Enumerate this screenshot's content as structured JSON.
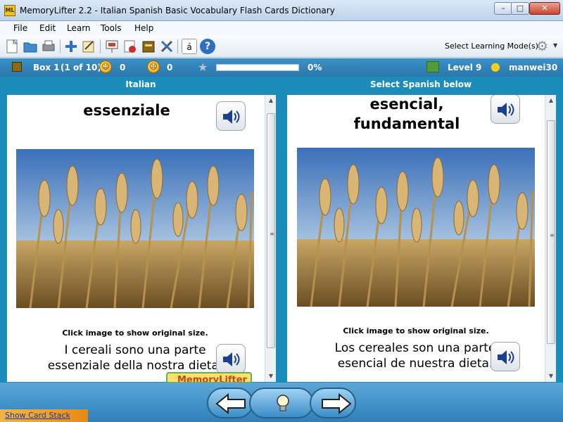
{
  "window": {
    "title": "MemoryLifter 2.2 - Italian Spanish Basic Vocabulary Flash Cards Dictionary",
    "app_icon_text": "ML",
    "minimize_glyph": "–",
    "maximize_glyph": "□",
    "close_glyph": "✕"
  },
  "menu": [
    "File",
    "Edit",
    "Learn",
    "Tools",
    "Help"
  ],
  "toolbar": {
    "icons": [
      "new-file-icon",
      "open-folder-icon",
      "print-icon",
      "add-card-icon",
      "edit-card-icon",
      "presentation-icon",
      "statistics-icon",
      "card-stack-icon",
      "tools-icon",
      "special-characters-icon",
      "help-icon"
    ],
    "special_char_glyph": "á",
    "help_glyph": "?",
    "learning_mode_label": "Select Learning Mode(s)"
  },
  "status": {
    "box": "Box 1",
    "box_count": "(1 of 10)",
    "correct_count": "0",
    "wrong_count": "0",
    "progress_text": "0%",
    "progress_fraction": 0,
    "level": "Level 9",
    "user": "manwei30"
  },
  "question": {
    "header": "Italian",
    "word": "essenziale",
    "image_hint": "Click image to show original size.",
    "sentence": "I cereali sono una parte essenziale della nostra dieta."
  },
  "answer": {
    "header": "Select Spanish below",
    "word": "esencial, fundamental",
    "image_hint": "Click image to show original size.",
    "sentence": "Los cereales son una parte esencial de nuestra dieta."
  },
  "bottom": {
    "show_card_stack": "Show Card Stack",
    "logo_text": "MemoryLifter"
  },
  "colors": {
    "accent": "#1c8cbb",
    "status_bar": "#2a76ad",
    "orange_tab": "#e88a13"
  }
}
